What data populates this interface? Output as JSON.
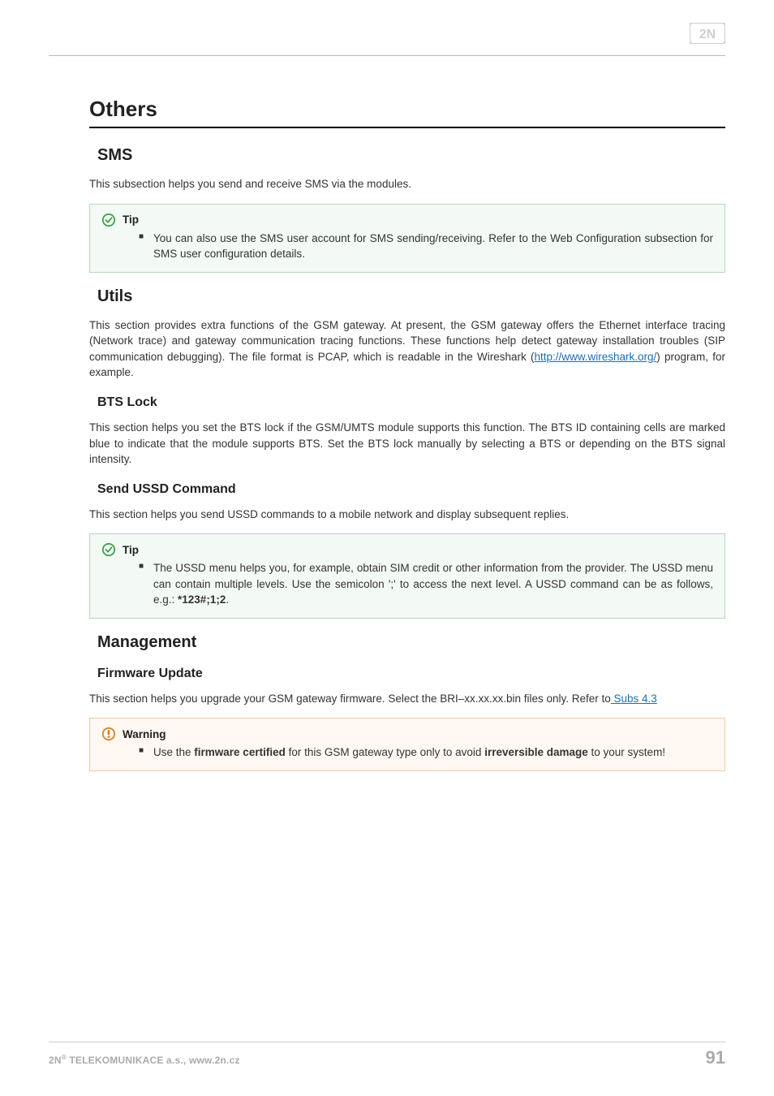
{
  "logo_text": "2N",
  "others": {
    "heading": "Others",
    "sms": {
      "heading": "SMS",
      "intro": "This subsection helps you send and receive SMS via the modules.",
      "tip_label": "Tip",
      "tip_item": "You can also use the SMS user account for SMS sending/receiving. Refer to the Web Configuration subsection for SMS user configuration details."
    },
    "utils": {
      "heading": "Utils",
      "para_pre": "This section provides extra functions of the GSM gateway. At present, the GSM gateway offers the Ethernet interface tracing (Network trace) and gateway communication tracing functions. These functions help detect gateway installation troubles (SIP communication debugging). The file format is PCAP, which is readable in the Wireshark (",
      "link_text": "http://www.wireshark.org/",
      "para_post": ") program, for example.",
      "bts": {
        "heading": "BTS Lock",
        "para": "This section helps you set the BTS lock if the GSM/UMTS module supports this function. The BTS ID containing cells are marked blue to indicate that the module supports BTS. Set the BTS lock manually by selecting a BTS or depending on the BTS signal intensity."
      },
      "ussd": {
        "heading": "Send USSD Command",
        "para": "This section helps you send USSD commands to a mobile network and display subsequent replies.",
        "tip_label": "Tip",
        "tip_item_pre": "The USSD menu helps you, for example, obtain SIM credit or other information from the provider. The USSD menu can contain multiple levels. Use the semicolon ';' to access the next level. A USSD command can be as follows, e.g.: ",
        "tip_item_bold": "*123#;1;2",
        "tip_item_post": "."
      }
    },
    "management": {
      "heading": "Management",
      "fw": {
        "heading": "Firmware Update",
        "para_pre": "This section helps you upgrade your GSM gateway firmware. Select the BRI–xx.xx.xx.bin files only. Refer to",
        "link_text": " Subs 4.3 ",
        "warn_label": "Warning",
        "warn_pre": "Use the ",
        "warn_b1": "firmware certified",
        "warn_mid": " for this GSM gateway type only to avoid ",
        "warn_b2": "irreversible damage",
        "warn_post": " to your system!"
      }
    }
  },
  "footer": {
    "left_pre": "2N",
    "left_sup": "®",
    "left_post": " TELEKOMUNIKACE a.s., www.2n.cz",
    "page_number": "91"
  }
}
